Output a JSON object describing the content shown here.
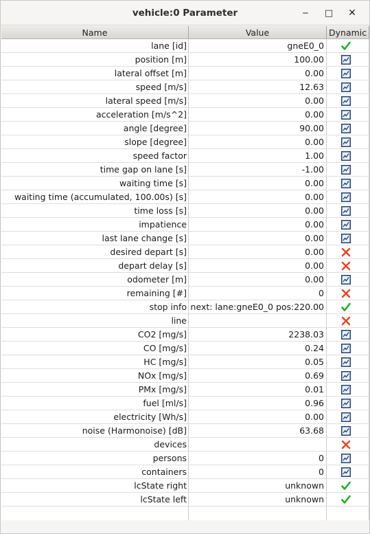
{
  "window": {
    "title": "vehicle:0 Parameter"
  },
  "controls": {
    "minimize": "‒",
    "maximize": "□",
    "close": "✕"
  },
  "table": {
    "headers": [
      "Name",
      "Value",
      "Dynamic"
    ],
    "rows": [
      {
        "name": "lane [id]",
        "value": "gneE0_0",
        "icon": "check"
      },
      {
        "name": "position [m]",
        "value": "100.00",
        "icon": "chart"
      },
      {
        "name": "lateral offset [m]",
        "value": "0.00",
        "icon": "chart"
      },
      {
        "name": "speed [m/s]",
        "value": "12.63",
        "icon": "chart"
      },
      {
        "name": "lateral speed [m/s]",
        "value": "0.00",
        "icon": "chart"
      },
      {
        "name": "acceleration [m/s^2]",
        "value": "0.00",
        "icon": "chart"
      },
      {
        "name": "angle [degree]",
        "value": "90.00",
        "icon": "chart"
      },
      {
        "name": "slope [degree]",
        "value": "0.00",
        "icon": "chart"
      },
      {
        "name": "speed factor",
        "value": "1.00",
        "icon": "chart"
      },
      {
        "name": "time gap on lane [s]",
        "value": "-1.00",
        "icon": "chart"
      },
      {
        "name": "waiting time [s]",
        "value": "0.00",
        "icon": "chart"
      },
      {
        "name": "waiting time (accumulated, 100.00s) [s]",
        "value": "0.00",
        "icon": "chart"
      },
      {
        "name": "time loss [s]",
        "value": "0.00",
        "icon": "chart"
      },
      {
        "name": "impatience",
        "value": "0.00",
        "icon": "chart"
      },
      {
        "name": "last lane change [s]",
        "value": "0.00",
        "icon": "chart"
      },
      {
        "name": "desired depart [s]",
        "value": "0.00",
        "icon": "cross"
      },
      {
        "name": "depart delay [s]",
        "value": "0.00",
        "icon": "cross"
      },
      {
        "name": "odometer [m]",
        "value": "0.00",
        "icon": "chart"
      },
      {
        "name": "remaining [#]",
        "value": "0",
        "icon": "cross"
      },
      {
        "name": "stop info",
        "value": "next: lane:gneE0_0 pos:220.00",
        "icon": "check"
      },
      {
        "name": "line",
        "value": "",
        "icon": "cross"
      },
      {
        "name": "CO2 [mg/s]",
        "value": "2238.03",
        "icon": "chart"
      },
      {
        "name": "CO [mg/s]",
        "value": "0.24",
        "icon": "chart"
      },
      {
        "name": "HC [mg/s]",
        "value": "0.05",
        "icon": "chart"
      },
      {
        "name": "NOx [mg/s]",
        "value": "0.69",
        "icon": "chart"
      },
      {
        "name": "PMx [mg/s]",
        "value": "0.01",
        "icon": "chart"
      },
      {
        "name": "fuel [ml/s]",
        "value": "0.96",
        "icon": "chart"
      },
      {
        "name": "electricity [Wh/s]",
        "value": "0.00",
        "icon": "chart"
      },
      {
        "name": "noise (Harmonoise) [dB]",
        "value": "63.68",
        "icon": "chart"
      },
      {
        "name": "devices",
        "value": "",
        "icon": "cross"
      },
      {
        "name": "persons",
        "value": "0",
        "icon": "chart"
      },
      {
        "name": "containers",
        "value": "0",
        "icon": "chart"
      },
      {
        "name": "lcState right",
        "value": "unknown",
        "icon": "check"
      },
      {
        "name": "lcState left",
        "value": "unknown",
        "icon": "check"
      }
    ]
  },
  "colors": {
    "check": "#1fb11f",
    "cross": "#f0421c",
    "chart_border": "#1c3f7a",
    "chart_bg": "#eaf1fb"
  }
}
